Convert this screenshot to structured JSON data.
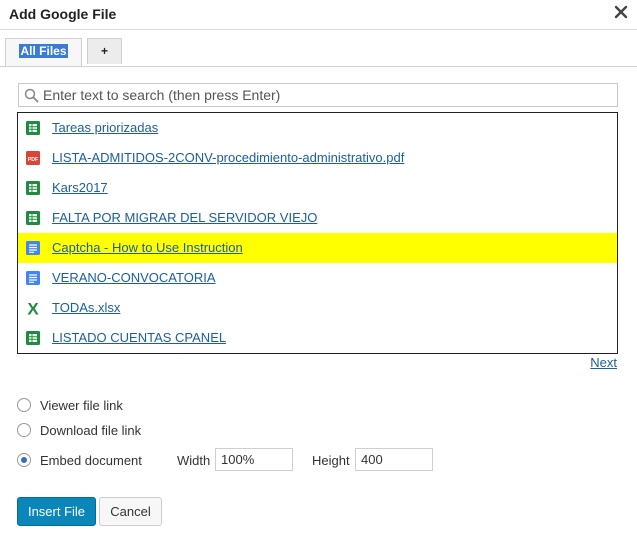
{
  "dialog": {
    "title": "Add Google File"
  },
  "tabs": [
    {
      "label": "All Files",
      "active": true
    },
    {
      "label": "+"
    }
  ],
  "search": {
    "placeholder": "Enter text to search (then press Enter)",
    "value": ""
  },
  "files": [
    {
      "name": "Tareas priorizadas",
      "icon": "spreadsheet-icon"
    },
    {
      "name": "LISTA-ADMITIDOS-2CONV-procedimiento-administrativo.pdf",
      "icon": "pdf-icon"
    },
    {
      "name": "Kars2017",
      "icon": "spreadsheet-icon"
    },
    {
      "name": "FALTA POR MIGRAR DEL SERVIDOR VIEJO",
      "icon": "spreadsheet-icon"
    },
    {
      "name": "Captcha - How to Use Instruction",
      "icon": "document-icon",
      "selected": true
    },
    {
      "name": "VERANO-CONVOCATORIA",
      "icon": "document-icon"
    },
    {
      "name": "TODAs.xlsx",
      "icon": "excel-icon"
    },
    {
      "name": "LISTADO CUENTAS CPANEL",
      "icon": "spreadsheet-icon"
    }
  ],
  "pagination": {
    "next_label": "Next"
  },
  "options": {
    "viewer_label": "Viewer file link",
    "download_label": "Download file link",
    "embed_label": "Embed document",
    "selected": "embed",
    "width_label": "Width",
    "width_value": "100%",
    "height_label": "Height",
    "height_value": "400"
  },
  "buttons": {
    "insert_label": "Insert File",
    "cancel_label": "Cancel"
  },
  "colors": {
    "highlight": "#ffff00",
    "link": "#1a5fa0",
    "primary_button": "#0a86b9",
    "sheet_green": "#1e8e3e",
    "doc_blue": "#4285f4",
    "pdf_red": "#db4437",
    "tab_selection": "#3a7bd5"
  }
}
